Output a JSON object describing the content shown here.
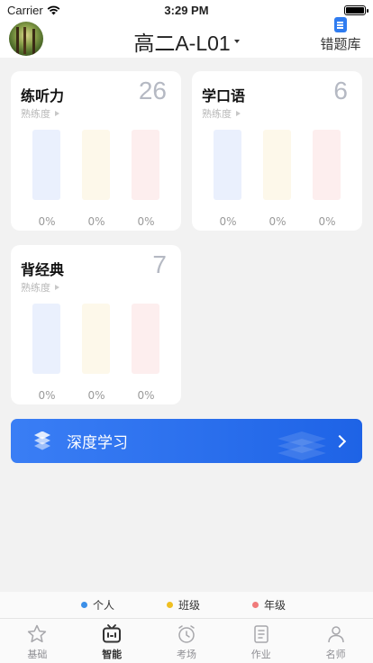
{
  "status_bar": {
    "carrier": "Carrier",
    "time": "3:29 PM"
  },
  "header": {
    "title": "高二A-L01",
    "wrong_book": "错题库"
  },
  "cards": [
    {
      "title": "练听力",
      "count": "26",
      "sub": "熟练度",
      "pcts": [
        "0%",
        "0%",
        "0%"
      ]
    },
    {
      "title": "学口语",
      "count": "6",
      "sub": "熟练度",
      "pcts": [
        "0%",
        "0%",
        "0%"
      ]
    },
    {
      "title": "背经典",
      "count": "7",
      "sub": "熟练度",
      "pcts": [
        "0%",
        "0%",
        "0%"
      ]
    }
  ],
  "deep_learning": {
    "label": "深度学习"
  },
  "legend": [
    {
      "label": "个人",
      "color": "#3b8fe8"
    },
    {
      "label": "班级",
      "color": "#efbf22"
    },
    {
      "label": "年级",
      "color": "#f07b7b"
    }
  ],
  "tabs": [
    {
      "label": "基础",
      "icon": "star-icon"
    },
    {
      "label": "智能",
      "icon": "tv-icon",
      "active": true
    },
    {
      "label": "考场",
      "icon": "clock-icon"
    },
    {
      "label": "作业",
      "icon": "notebook-icon"
    },
    {
      "label": "名师",
      "icon": "person-icon"
    }
  ]
}
